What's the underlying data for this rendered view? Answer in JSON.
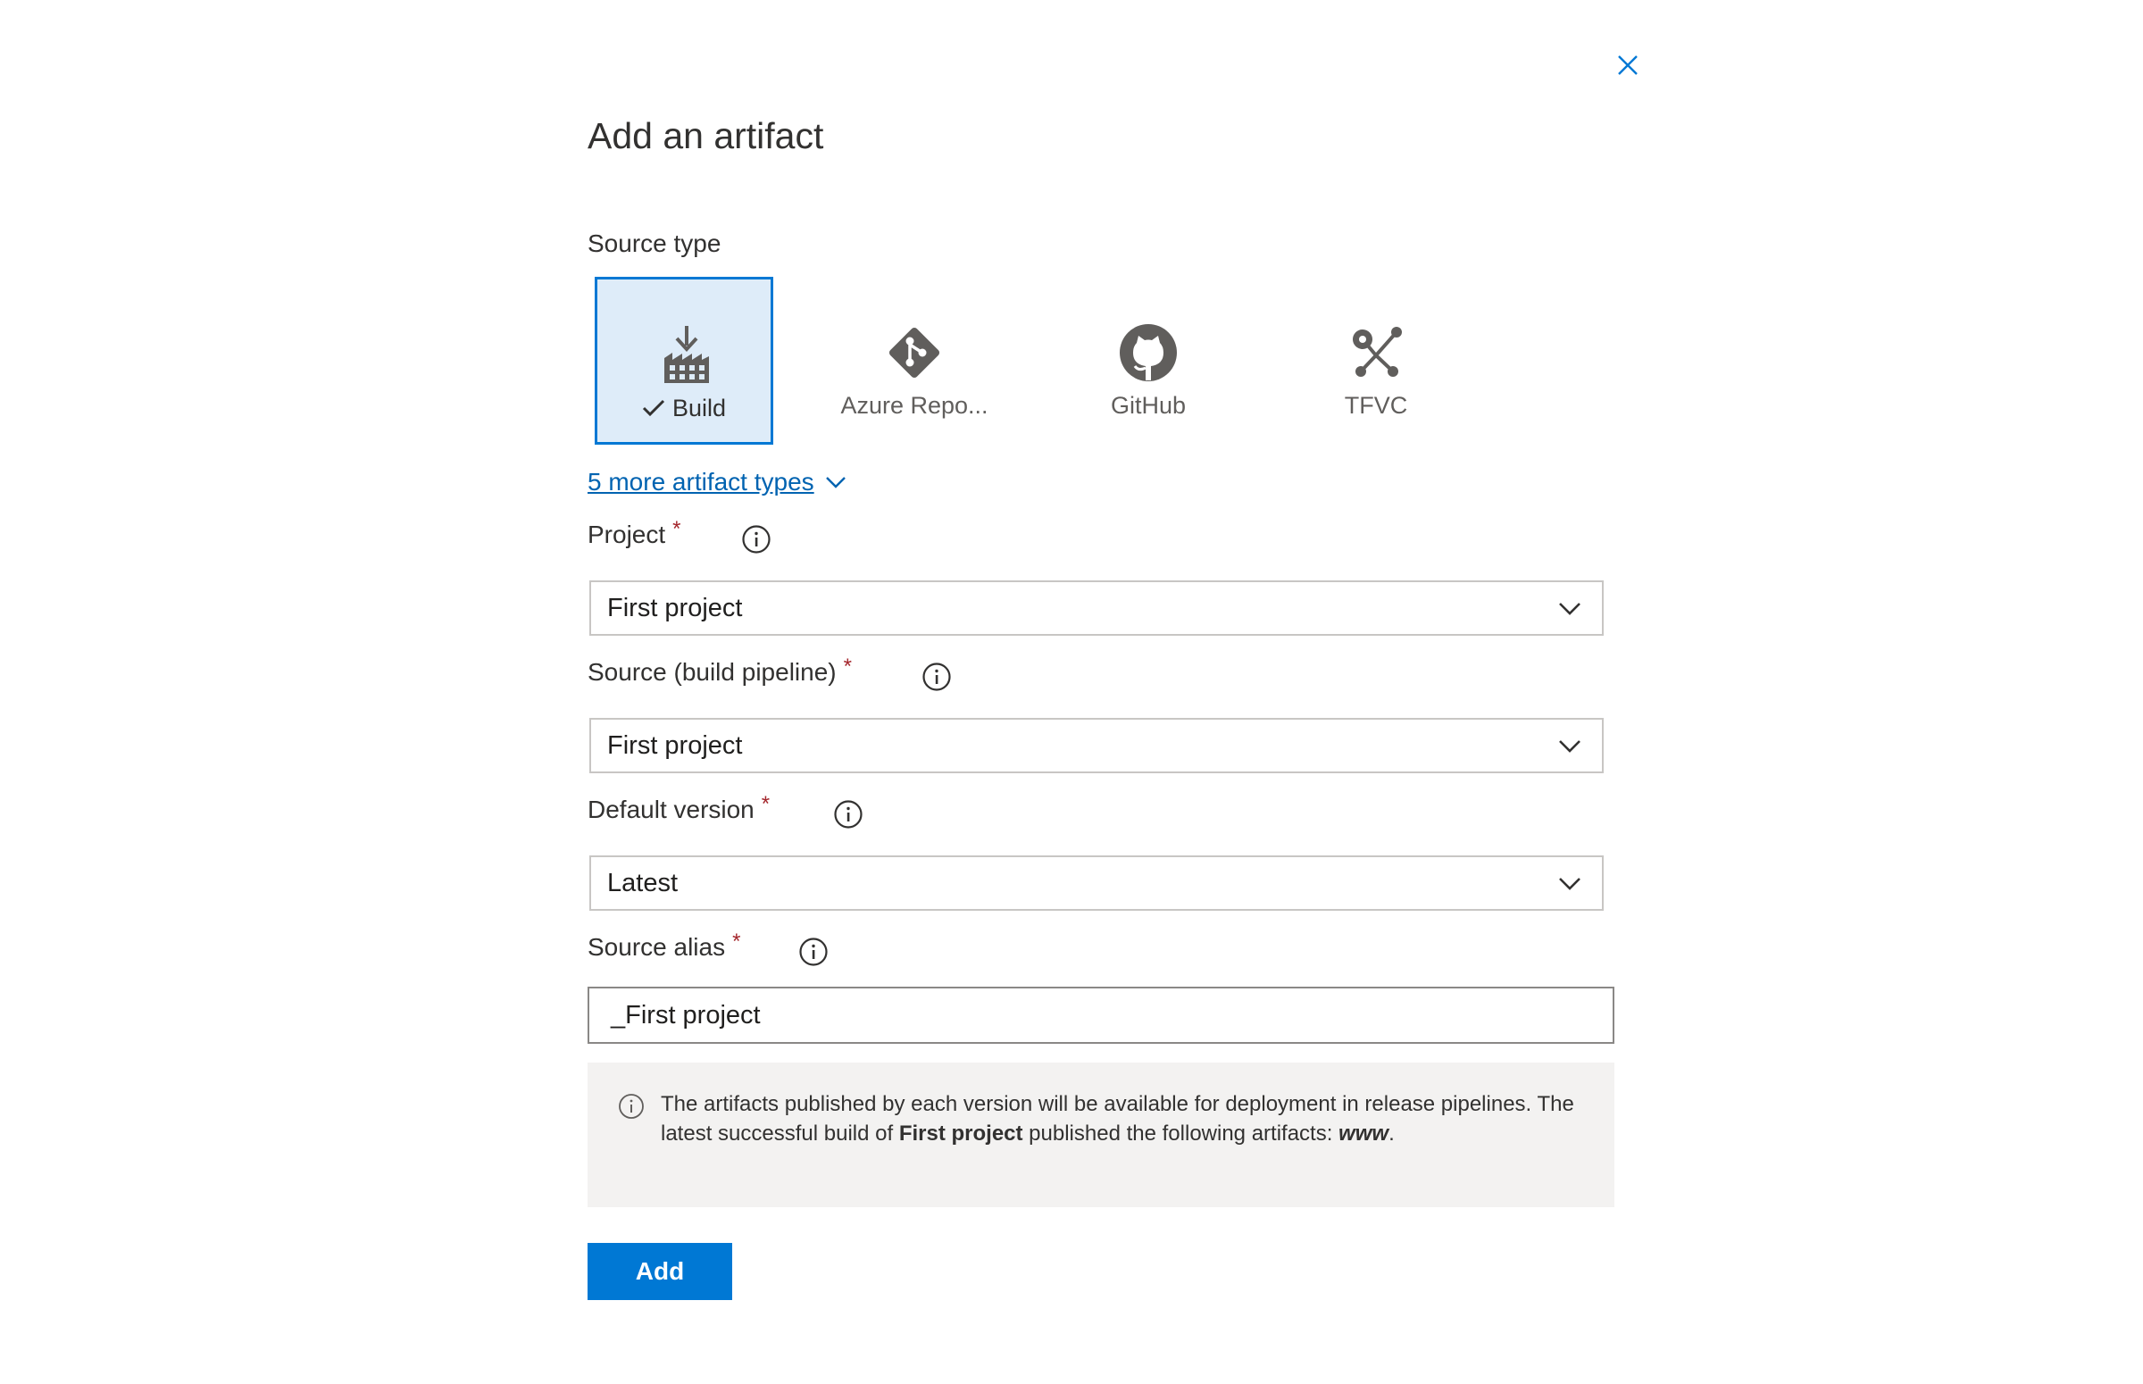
{
  "dialog": {
    "title": "Add an artifact"
  },
  "source_type": {
    "label": "Source type",
    "tiles": [
      {
        "label": "Build",
        "icon": "build-icon",
        "selected": true
      },
      {
        "label": "Azure Repo...",
        "icon": "azure-repos-icon",
        "selected": false
      },
      {
        "label": "GitHub",
        "icon": "github-icon",
        "selected": false
      },
      {
        "label": "TFVC",
        "icon": "tfvc-icon",
        "selected": false
      }
    ],
    "more_link": "5 more artifact types"
  },
  "fields": {
    "project": {
      "label": "Project",
      "required_mark": "*",
      "value": "First project"
    },
    "source": {
      "label": "Source (build pipeline)",
      "required_mark": "*",
      "value": "First project"
    },
    "default_version": {
      "label": "Default version",
      "required_mark": "*",
      "value": "Latest"
    },
    "source_alias": {
      "label": "Source alias",
      "required_mark": "*",
      "value": "_First project"
    }
  },
  "notice": {
    "text_1": "The artifacts published by each version will be available for deployment in release pipelines. The latest successful build of ",
    "project_name": "First project",
    "text_2": "  published the following artifacts: ",
    "artifact_name": "www",
    "text_3": "."
  },
  "actions": {
    "add_label": "Add"
  },
  "colors": {
    "accent": "#0078d4",
    "link": "#0063b1",
    "required": "#a4262c",
    "selected_tile_bg": "#deecf9",
    "notice_bg": "#f3f2f1"
  }
}
